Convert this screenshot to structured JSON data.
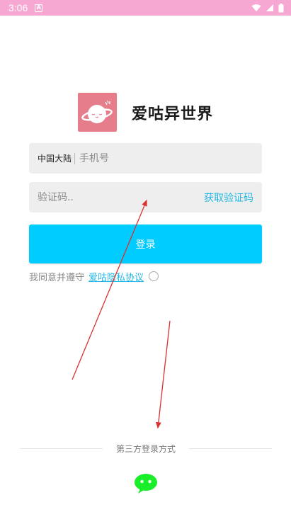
{
  "status_bar": {
    "time": "3:06",
    "notification_icon": "a-letter-icon",
    "signal_icons": [
      "wifi-icon",
      "cellular-signal-icon",
      "battery-icon"
    ],
    "background_color": "#f7a8d2"
  },
  "app": {
    "name": "爱咕异世界",
    "logo_color": "#e57d8b",
    "logo_icon": "planet-face-icon"
  },
  "phone_field": {
    "region": "中国大陆",
    "placeholder": "手机号",
    "value": ""
  },
  "code_field": {
    "placeholder": "验证码..",
    "value": "",
    "get_code_label": "获取验证码"
  },
  "login": {
    "label": "登录",
    "color": "#00ccff"
  },
  "agreement": {
    "prefix": "我同意并遵守",
    "link_text": "爱咕隐私协议",
    "checked": false
  },
  "third_party": {
    "label": "第三方登录方式",
    "options": [
      "wechat-icon"
    ]
  },
  "colors": {
    "accent": "#22b8e8",
    "wechat": "#1aee2a",
    "annotation_arrow": "#d93030"
  }
}
